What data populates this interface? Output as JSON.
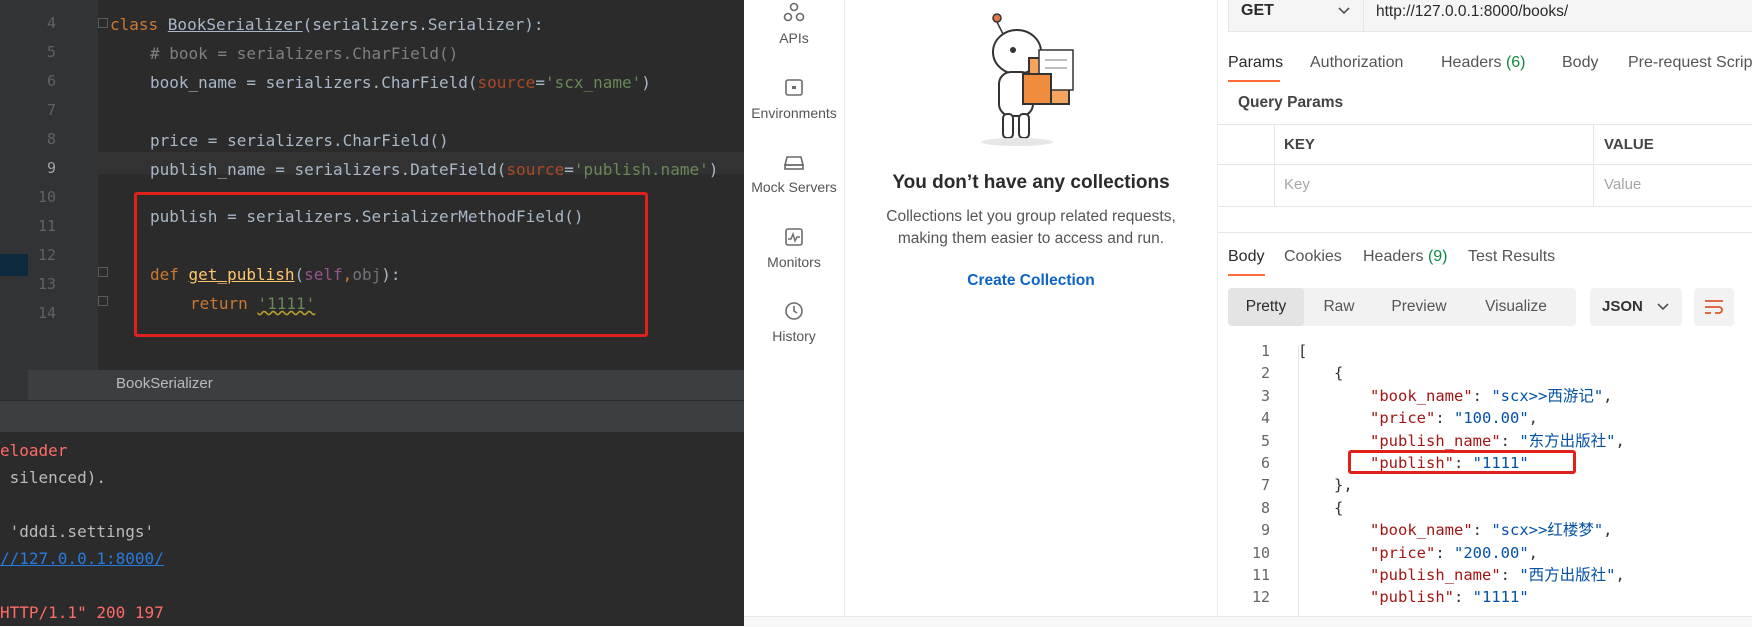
{
  "ide": {
    "line_numbers": [
      "4",
      "5",
      "6",
      "7",
      "8",
      "9",
      "10",
      "11",
      "12",
      "13",
      "14"
    ],
    "code": {
      "l4_kw": "class ",
      "l4_name": "BookSerializer",
      "l4_rest": "(serializers.Serializer):",
      "l5": "# book = serializers.CharField()",
      "l6_a": "book_name = serializers.CharField(",
      "l6_p": "source",
      "l6_eq": "=",
      "l6_s": "'scx_name'",
      "l6_end": ")",
      "l8": "price = serializers.CharField()",
      "l9_a": "publish_name = serializers.DateField(",
      "l9_p": "source",
      "l9_eq": "=",
      "l9_s": "'publish.name'",
      "l9_end": ")",
      "l11": "publish = serializers.SerializerMethodField()",
      "l13_kw": "def ",
      "l13_fn": "get_publish",
      "l13_p1": "(",
      "l13_self": "self",
      "l13_comma": ",",
      "l13_obj": "obj",
      "l13_end": "):",
      "l14_kw": "return ",
      "l14_s": "'1111'"
    },
    "breadcrumb": "BookSerializer",
    "terminal": [
      {
        "text": "eloader",
        "color": "#ff6b68"
      },
      {
        "text": " silenced).",
        "color": "#bbbbbb"
      },
      {
        "text": "",
        "color": "#bbbbbb"
      },
      {
        "text": " 'dddi.settings'",
        "color": "#bbbbbb"
      },
      {
        "text": "//127.0.0.1:8000/",
        "color": "#287bde"
      },
      {
        "text": "",
        "color": "#bbbbbb"
      },
      {
        "text": "HTTP/1.1\" 200 197",
        "color": "#ff6b68"
      }
    ]
  },
  "sidebar": {
    "items": [
      {
        "label": "APIs",
        "icon": "apis-icon"
      },
      {
        "label": "Environments",
        "icon": "environments-icon"
      },
      {
        "label": "Mock Servers",
        "icon": "mock-servers-icon"
      },
      {
        "label": "Monitors",
        "icon": "monitors-icon"
      },
      {
        "label": "History",
        "icon": "history-icon"
      }
    ]
  },
  "collections": {
    "title": "You don’t have any collections",
    "description": "Collections let you group related requests, making them easier to access and run.",
    "create_label": "Create Collection"
  },
  "request": {
    "method": "GET",
    "url": "http://127.0.0.1:8000/books/",
    "tabs": {
      "params": "Params",
      "authorization": "Authorization",
      "headers": "Headers",
      "headers_count": "(6)",
      "body": "Body",
      "prerequest": "Pre-request Scrip"
    },
    "query_params_title": "Query Params",
    "table": {
      "key_header": "KEY",
      "value_header": "VALUE",
      "key_placeholder": "Key",
      "value_placeholder": "Value"
    }
  },
  "response": {
    "tabs": {
      "body": "Body",
      "cookies": "Cookies",
      "headers": "Headers",
      "headers_count": "(9)",
      "tests": "Test Results"
    },
    "view_modes": [
      "Pretty",
      "Raw",
      "Preview",
      "Visualize"
    ],
    "active_view": "Pretty",
    "format": "JSON",
    "lines": [
      "1",
      "2",
      "3",
      "4",
      "5",
      "6",
      "7",
      "8",
      "9",
      "10",
      "11",
      "12"
    ],
    "json": {
      "l1": "[",
      "l2": "{",
      "l3_k": "\"book_name\"",
      "l3_v": "\"scx>>西游记\"",
      "l4_k": "\"price\"",
      "l4_v": "\"100.00\"",
      "l5_k": "\"publish_name\"",
      "l5_v": "\"东方出版社\"",
      "l6_k": "\"publish\"",
      "l6_v": "\"1111\"",
      "l7": "},",
      "l8": "{",
      "l9_k": "\"book_name\"",
      "l9_v": "\"scx>>红楼梦\"",
      "l10_k": "\"price\"",
      "l10_v": "\"200.00\"",
      "l11_k": "\"publish_name\"",
      "l11_v": "\"西方出版社\"",
      "l12_k": "\"publish\"",
      "l12_v": "\"1111\""
    }
  },
  "colors": {
    "accent": "#ff6c37",
    "link": "#0b63c6",
    "highlight_box": "#e0201b",
    "count_green": "#0c8a3e"
  }
}
